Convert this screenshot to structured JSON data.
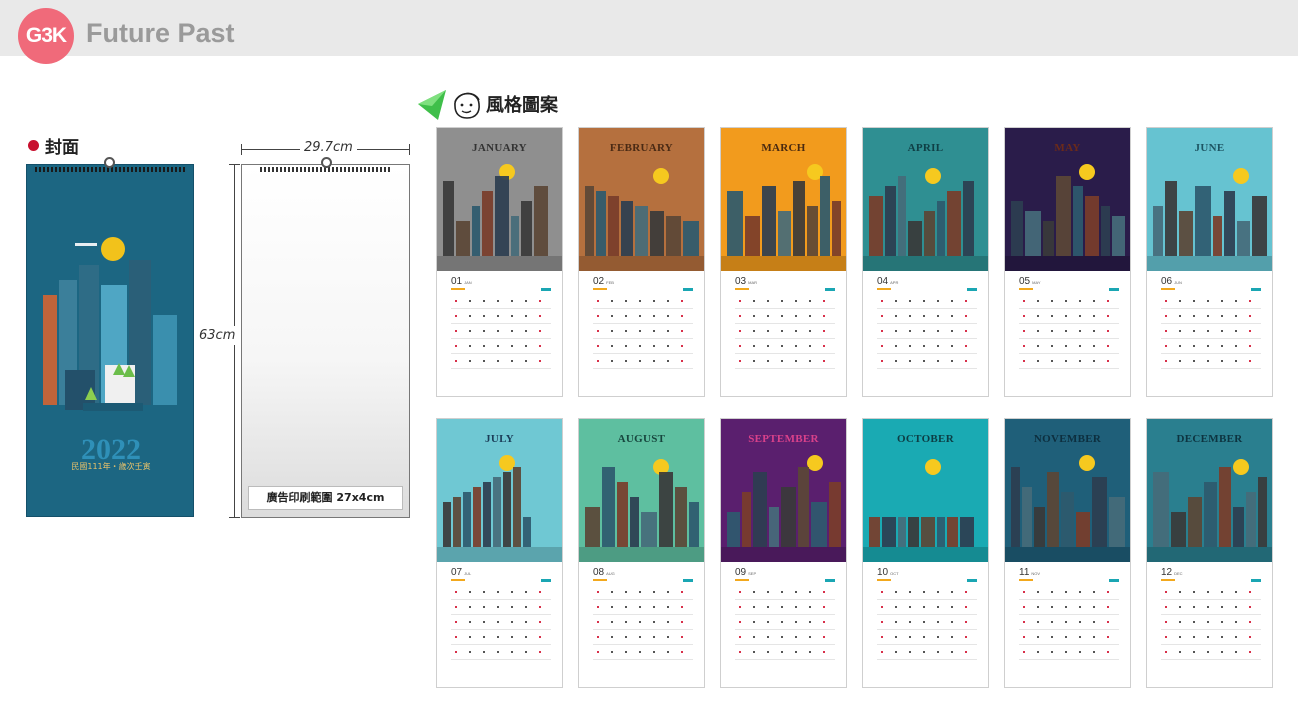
{
  "header": {
    "logo_text": "G3K",
    "brand": "Future Past"
  },
  "cover": {
    "label": "封面",
    "year": "2022",
    "subtitle": "民國111年・歲次壬寅"
  },
  "dimensions": {
    "width_label": "29.7cm",
    "height_label": "63cm",
    "ad_area": "廣告印刷範圍 27x4cm"
  },
  "style": {
    "label": "風格圖案"
  },
  "months": [
    {
      "name": "JANUARY",
      "num": "01",
      "abbr": "JAN",
      "bg": "#8f8f8f",
      "title_color": "#333333"
    },
    {
      "name": "FEBRUARY",
      "num": "02",
      "abbr": "FEB",
      "bg": "#b5703e",
      "title_color": "#4a2a14"
    },
    {
      "name": "MARCH",
      "num": "03",
      "abbr": "MAR",
      "bg": "#f29b1d",
      "title_color": "#4a2a10"
    },
    {
      "name": "APRIL",
      "num": "04",
      "abbr": "APR",
      "bg": "#2f8f92",
      "title_color": "#0f3f45"
    },
    {
      "name": "MAY",
      "num": "05",
      "abbr": "MAY",
      "bg": "#2a1c4a",
      "title_color": "#6b2a1a"
    },
    {
      "name": "JUNE",
      "num": "06",
      "abbr": "JUN",
      "bg": "#66c3d1",
      "title_color": "#1d5563"
    },
    {
      "name": "JULY",
      "num": "07",
      "abbr": "JUL",
      "bg": "#6fc8d3",
      "title_color": "#1b3d58"
    },
    {
      "name": "AUGUST",
      "num": "08",
      "abbr": "AUG",
      "bg": "#5ebfa0",
      "title_color": "#17463e"
    },
    {
      "name": "SEPTEMBER",
      "num": "09",
      "abbr": "SEP",
      "bg": "#5a1f6e",
      "title_color": "#d8418a"
    },
    {
      "name": "OCTOBER",
      "num": "10",
      "abbr": "OCT",
      "bg": "#1aaab3",
      "title_color": "#0c3e45"
    },
    {
      "name": "NOVEMBER",
      "num": "11",
      "abbr": "NOV",
      "bg": "#1f5f79",
      "title_color": "#0d2f3f"
    },
    {
      "name": "DECEMBER",
      "num": "12",
      "abbr": "DEC",
      "bg": "#2a7f8f",
      "title_color": "#0d3440"
    }
  ]
}
